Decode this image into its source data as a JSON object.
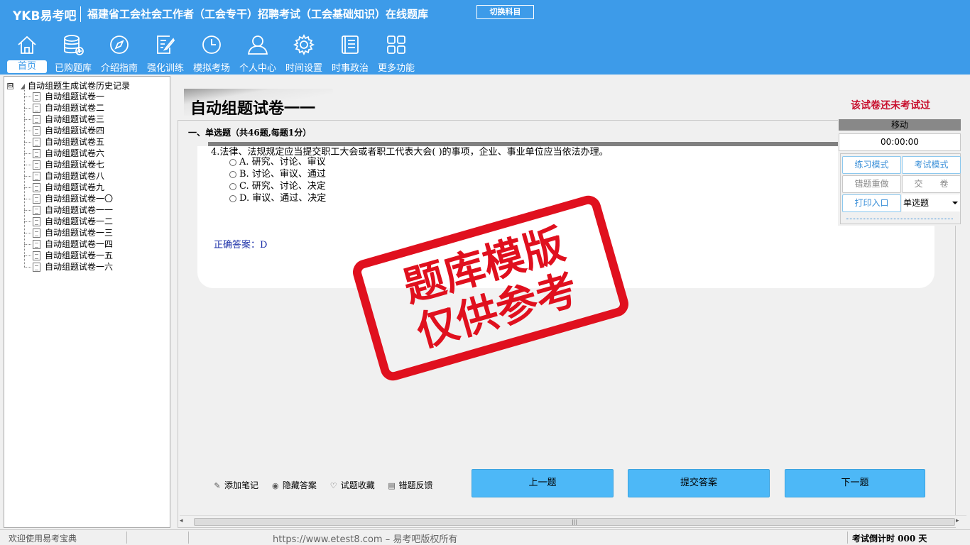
{
  "header": {
    "brand": "YKB易考吧",
    "title": "福建省工会社会工作者（工会专干）招聘考试（工会基础知识）在线题库",
    "switch_label": "切换科目"
  },
  "nav": [
    {
      "label": "首页",
      "icon": "home-icon"
    },
    {
      "label": "已购题库",
      "icon": "database-icon"
    },
    {
      "label": "介绍指南",
      "icon": "compass-icon"
    },
    {
      "label": "强化训练",
      "icon": "edit-icon"
    },
    {
      "label": "模拟考场",
      "icon": "clock-icon"
    },
    {
      "label": "个人中心",
      "icon": "user-icon"
    },
    {
      "label": "时间设置",
      "icon": "gear-icon"
    },
    {
      "label": "时事政治",
      "icon": "news-icon"
    },
    {
      "label": "更多功能",
      "icon": "grid-icon"
    }
  ],
  "tree": {
    "root": "自动组题生成试卷历史记录",
    "toggle": "⊟",
    "items": [
      "自动组题试卷一",
      "自动组题试卷二",
      "自动组题试卷三",
      "自动组题试卷四",
      "自动组题试卷五",
      "自动组题试卷六",
      "自动组题试卷七",
      "自动组题试卷八",
      "自动组题试卷九",
      "自动组题试卷一〇",
      "自动组题试卷一一",
      "自动组题试卷一二",
      "自动组题试卷一三",
      "自动组题试卷一四",
      "自动组题试卷一五",
      "自动组题试卷一六"
    ]
  },
  "paper": {
    "title": "自动组题试卷一一",
    "status": "该试卷还未考试过",
    "section": "一、单选题（共46题,每题1分）"
  },
  "question": {
    "text": "4.法律、法规规定应当提交职工大会或者职工代表大会( )的事项，企业、事业单位应当依法办理。",
    "options": [
      "A. 研究、讨论、审议",
      "B. 讨论、审议、通过",
      "C. 研究、讨论、决定",
      "D. 审议、通过、决定"
    ],
    "answer": "正确答案：D"
  },
  "tools": [
    {
      "label": "添加笔记",
      "icon": "✎"
    },
    {
      "label": "隐藏答案",
      "icon": "◉"
    },
    {
      "label": "试题收藏",
      "icon": "♡"
    },
    {
      "label": "错题反馈",
      "icon": "▤"
    }
  ],
  "buttons": {
    "prev": "上一题",
    "submit": "提交答案",
    "next": "下一题"
  },
  "control": {
    "move": "移动",
    "timer": "00:00:00",
    "practice": "练习模式",
    "exam": "考试模式",
    "redo": "错题重做",
    "handin": "交　　卷",
    "print": "打印入口",
    "type": "单选题"
  },
  "stamp": {
    "line1": "题库模版",
    "line2": "仅供参考"
  },
  "status": {
    "welcome": "欢迎使用易考宝典",
    "copyright": "https://www.etest8.com – 易考吧版权所有",
    "countdown": "考试倒计时 000 天"
  },
  "scroll": {
    "thumb": "|||",
    "left": "◂",
    "right": "▸"
  },
  "colors": {
    "primary": "#3d9be9",
    "button": "#4db8f7",
    "warn": "#c8102e",
    "stamp": "#e0101e",
    "answer": "#1a2ea8"
  }
}
